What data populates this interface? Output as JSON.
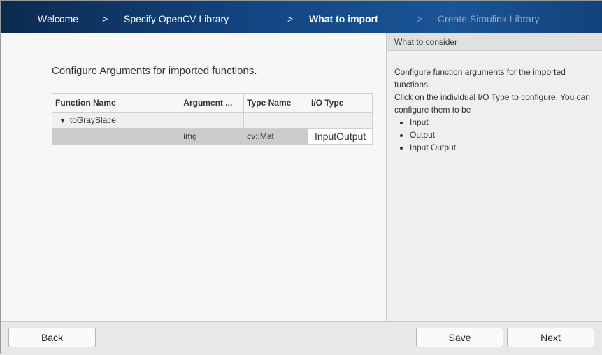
{
  "steps": {
    "welcome": "Welcome",
    "sep": ">",
    "specify": "Specify OpenCV Library",
    "import": "What to import",
    "create": "Create Simulink Library"
  },
  "main": {
    "title": "Configure Arguments for imported functions.",
    "columns": [
      "Function Name",
      "Argument ...",
      "Type Name",
      "I/O Type"
    ],
    "function": "toGraySlace",
    "arg": {
      "name": "img",
      "type": "cv::Mat",
      "io": "InputOutput"
    }
  },
  "side": {
    "title": "What to consider",
    "text1": "Configure function arguments for the imported functions.",
    "text2": "Click on the individual I/O Type to configure. You can configure them to be",
    "options": [
      "Input",
      "Output",
      "Input Output"
    ]
  },
  "footer": {
    "back": "Back",
    "save": "Save",
    "next": "Next"
  }
}
